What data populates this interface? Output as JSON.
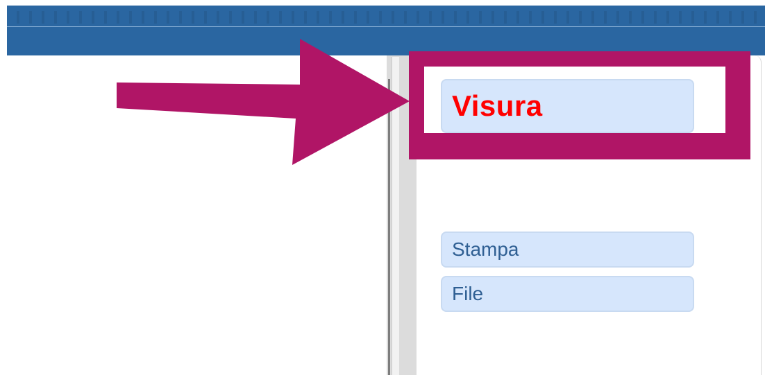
{
  "buttons": {
    "visura": "Visura",
    "stampa": "Stampa",
    "file": "File"
  },
  "colors": {
    "top_bar": "#2a66a1",
    "annotation": "#b01566",
    "button_fill": "#d6e6fc",
    "button_border": "#c8daf1",
    "highlight_text": "#ff0000",
    "button_text": "#2f5f93"
  },
  "annotations": {
    "arrow": "arrow-right-icon",
    "highlight": "highlight-box"
  }
}
